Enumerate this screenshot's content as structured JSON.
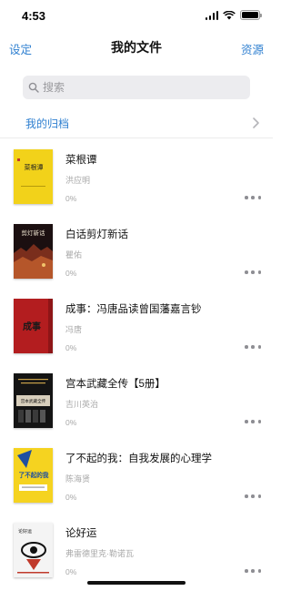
{
  "status_bar": {
    "time": "4:53",
    "signal_icon": "cellular-signal-icon",
    "wifi_icon": "wifi-icon",
    "battery_icon": "battery-icon"
  },
  "nav": {
    "left": "设定",
    "title": "我的文件",
    "right": "资源"
  },
  "search": {
    "placeholder": "搜索",
    "value": "",
    "icon": "search-icon"
  },
  "archive": {
    "label": "我的归档",
    "icon": "chevron-right-icon"
  },
  "books": [
    {
      "title": "菜根谭",
      "author": "洪应明",
      "progress": "0%",
      "cover_text": "菜根谭"
    },
    {
      "title": "白话剪灯新话",
      "author": "瞿佑",
      "progress": "0%",
      "cover_text": "剪灯新话"
    },
    {
      "title": "成事：冯唐品读曾国藩嘉言钞",
      "author": "冯唐",
      "progress": "0%",
      "cover_text": "成事"
    },
    {
      "title": "宫本武藏全传【5册】",
      "author": "吉川英治",
      "progress": "0%",
      "cover_text": "宫本武藏全传"
    },
    {
      "title": "了不起的我：自我发展的心理学",
      "author": "陈海贤",
      "progress": "0%",
      "cover_text": "了不起的我"
    },
    {
      "title": "论好运",
      "author": "弗雷德里克·勒诺瓦",
      "progress": "0%",
      "cover_text": "论好运"
    }
  ],
  "colors": {
    "accent": "#2e7fd0",
    "secondary_text": "#a8a8a8",
    "search_bg": "#ececef"
  }
}
